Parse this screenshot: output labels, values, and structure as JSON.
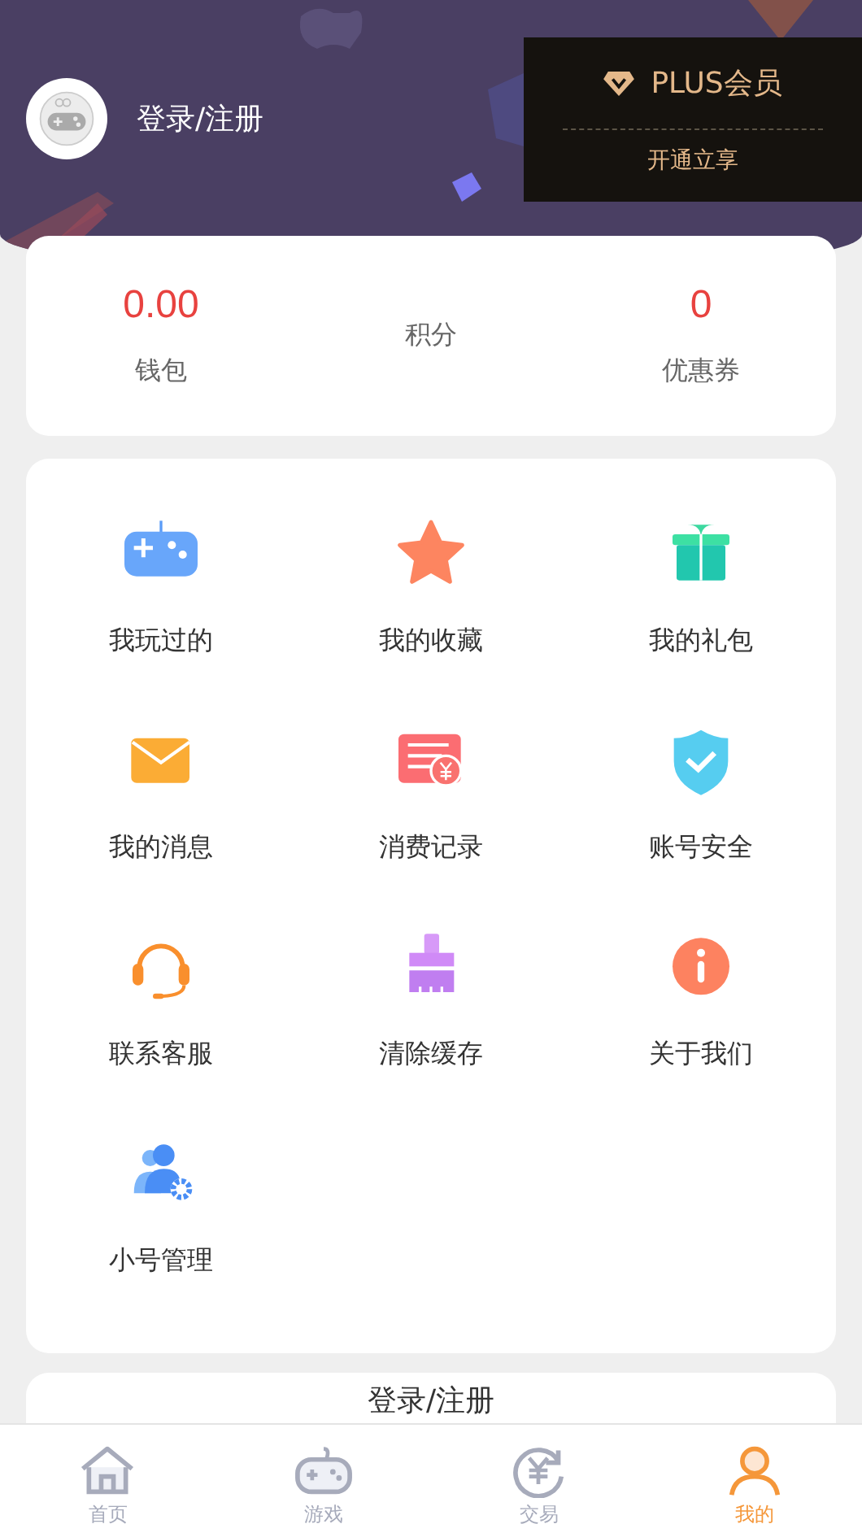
{
  "header": {
    "login_text": "登录/注册",
    "vip": {
      "title": "PLUS会员",
      "action": "开通立享"
    }
  },
  "stats": [
    {
      "value": "0.00",
      "label": "钱包"
    },
    {
      "label": "积分"
    },
    {
      "value": "0",
      "label": "优惠券"
    }
  ],
  "menu": [
    {
      "label": "我玩过的"
    },
    {
      "label": "我的收藏"
    },
    {
      "label": "我的礼包"
    },
    {
      "label": "我的消息"
    },
    {
      "label": "消费记录"
    },
    {
      "label": "账号安全"
    },
    {
      "label": "联系客服"
    },
    {
      "label": "清除缓存"
    },
    {
      "label": "关于我们"
    },
    {
      "label": "小号管理"
    }
  ],
  "login_button": "登录/注册",
  "tabbar": [
    {
      "label": "首页",
      "selected": false
    },
    {
      "label": "游戏",
      "selected": false
    },
    {
      "label": "交易",
      "selected": false
    },
    {
      "label": "我的",
      "selected": true
    }
  ]
}
